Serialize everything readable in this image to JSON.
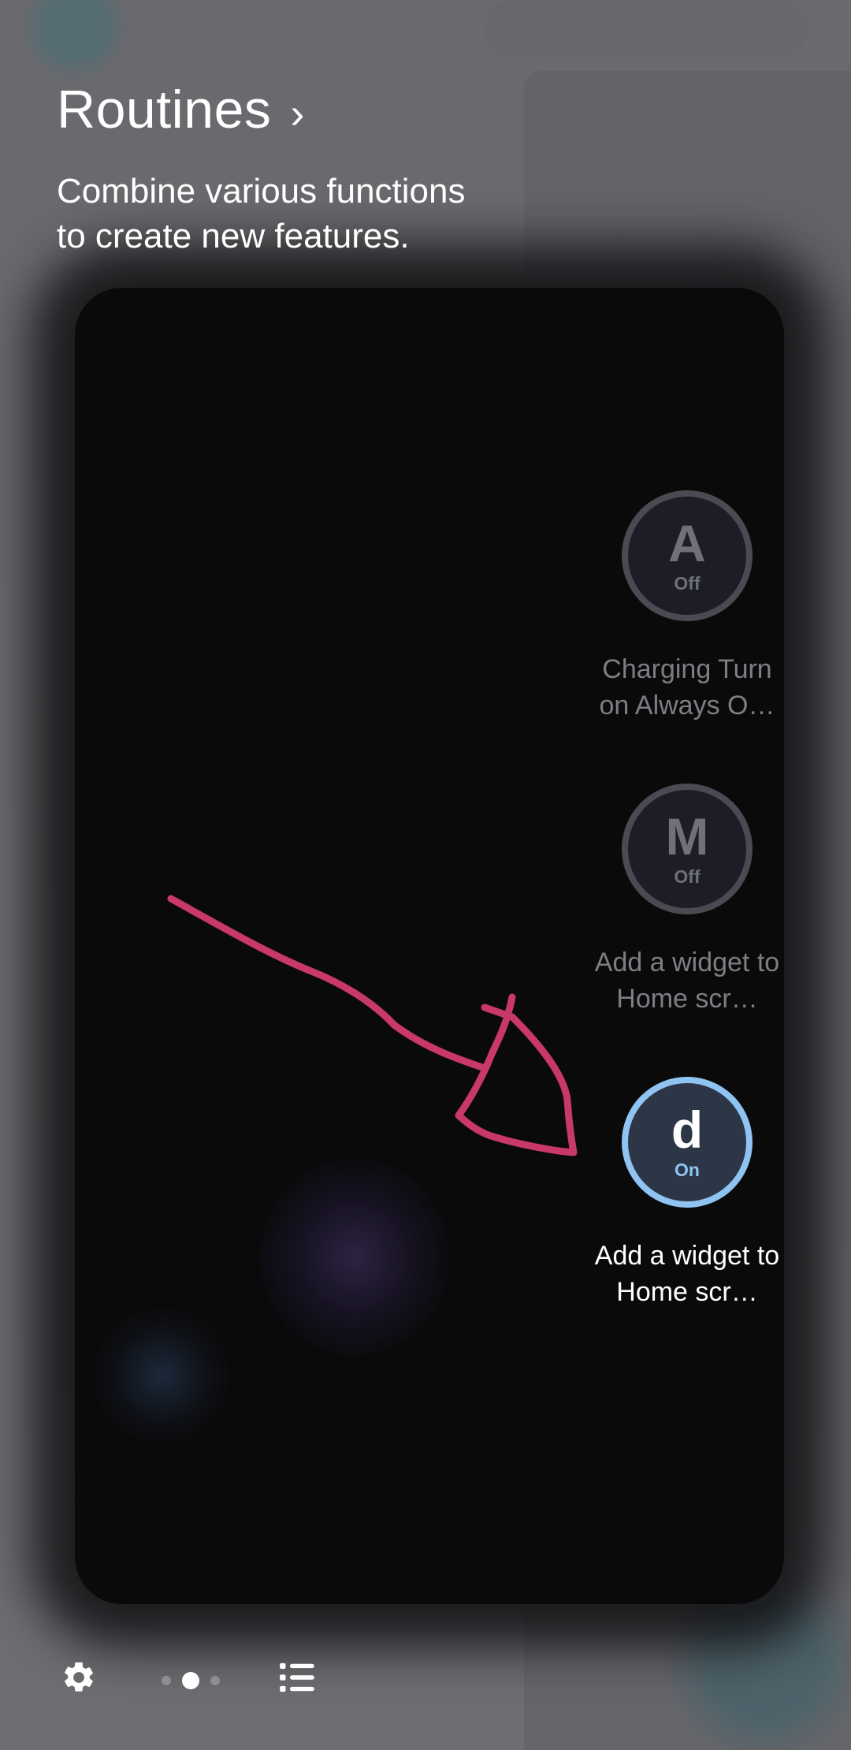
{
  "header": {
    "title": "Routines",
    "chevron": "›",
    "subtitle": "Combine various functions to create new features."
  },
  "routines": [
    {
      "letter": "A",
      "state": "Off",
      "label": "Charging Turn on Always O…",
      "active": false
    },
    {
      "letter": "M",
      "state": "Off",
      "label": "Add a widget to Home scr…",
      "active": false
    },
    {
      "letter": "d",
      "state": "On",
      "label": "Add a widget to Home scr…",
      "active": true
    }
  ],
  "bottom_bar": {
    "settings_icon": "gear-icon",
    "page_indicator": {
      "pages": 3,
      "current": 2
    },
    "list_icon": "list-icon"
  },
  "colors": {
    "background": "#6d6c70",
    "card": "#0b0a0b",
    "active_ring": "#8fc4f2",
    "drawing": "#d03a6e"
  }
}
